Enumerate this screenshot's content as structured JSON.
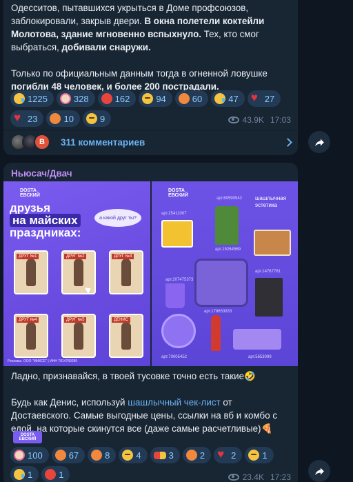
{
  "post1": {
    "text": {
      "line1": "Одесситов, пытавшихся укрыться в Доме профсоюзов,",
      "line2_plain": "заблокировали, закрыв двери. ",
      "line2_bold": "В окна полетели коктейли",
      "line3_bold": "Молотова, здание мгновенно вспыхнуло.",
      "line3_plain": " Тех, кто смог",
      "line4_plain": "выбраться, ",
      "line4_bold": "добивали снаружи.",
      "line5": "Только по официальным данным тогда в огненной ловушке",
      "line6_bold": "погибли 48 человек, и более 200 пострадали."
    },
    "reactions_row1": [
      {
        "icon": "crying-face-icon",
        "count": "1225"
      },
      {
        "icon": "clown-face-icon",
        "count": "328"
      },
      {
        "icon": "angry-face-icon",
        "count": "162"
      },
      {
        "icon": "grinning-face-icon",
        "count": "94"
      },
      {
        "icon": "thumbs-up-icon",
        "count": "60"
      },
      {
        "icon": "crying-face-icon",
        "count": "47"
      },
      {
        "icon": "broken-heart-icon",
        "count": "27"
      }
    ],
    "reactions_row2": [
      {
        "icon": "red-heart-icon",
        "count": "23"
      },
      {
        "icon": "middle-finger-icon",
        "count": "10"
      },
      {
        "icon": "neutral-face-icon",
        "count": "9"
      }
    ],
    "views": "43.9K",
    "time": "17:03",
    "comments_label": "311 комментариев",
    "avatar3_letter": "В"
  },
  "post2": {
    "sender": "Ньюсач/Двач",
    "image_left": {
      "brand": "DOSTA\nЕВСКИЙ",
      "headline1": "друзья",
      "headline2": "на майских",
      "headline3": "праздниках:",
      "bubble": "а какой друг ты?",
      "cards": [
        "ДРУГ №1",
        "ДРУГ №2",
        "ДРУГ №3",
        "ДРУГ №4",
        "ДРУГ №5",
        "ДЕНИС"
      ],
      "footer": "Реклама. ООО \"МИКСЕ\" | ИНН 7814789289"
    },
    "image_right": {
      "title": "шашлычная\nэстетика",
      "labels": [
        "арт.25411007",
        "арт.60590542",
        "арт.15264569",
        "арт.207475373",
        "арт.14767781",
        "арт.178653833",
        "арт.70005452",
        "арт.5653099"
      ]
    },
    "text": {
      "line1": "Ладно, признавайся, в твоей тусовке точно есть такие🤣",
      "line2_pre": "Будь как Денис, используй ",
      "line2_link": "шашлычный чек-лист",
      "line2_post": " от",
      "line3": "Достаевского. Самые выгодные цены, ссылки на вб и комбо с",
      "line4": "едой, на которые скинутся все (даже самые расчетливые)🍕"
    },
    "sticker": "DOSTA\nЕВСКИЙ",
    "reactions_row1": [
      {
        "icon": "clown-face-icon",
        "count": "100"
      },
      {
        "icon": "middle-finger-icon",
        "count": "67"
      },
      {
        "icon": "thumbs-down-icon",
        "count": "8"
      },
      {
        "icon": "neutral-face-icon",
        "count": "4"
      },
      {
        "icon": "pill-icon",
        "count": "3"
      },
      {
        "icon": "thumbs-up-icon",
        "count": "2"
      },
      {
        "icon": "red-heart-icon",
        "count": "2"
      },
      {
        "icon": "grinning-face-icon",
        "count": "1"
      }
    ],
    "reactions_row2": [
      {
        "icon": "rofl-face-icon",
        "count": "1"
      },
      {
        "icon": "angry-face-icon",
        "count": "1"
      }
    ],
    "views": "23.4K",
    "time": "17:23"
  }
}
